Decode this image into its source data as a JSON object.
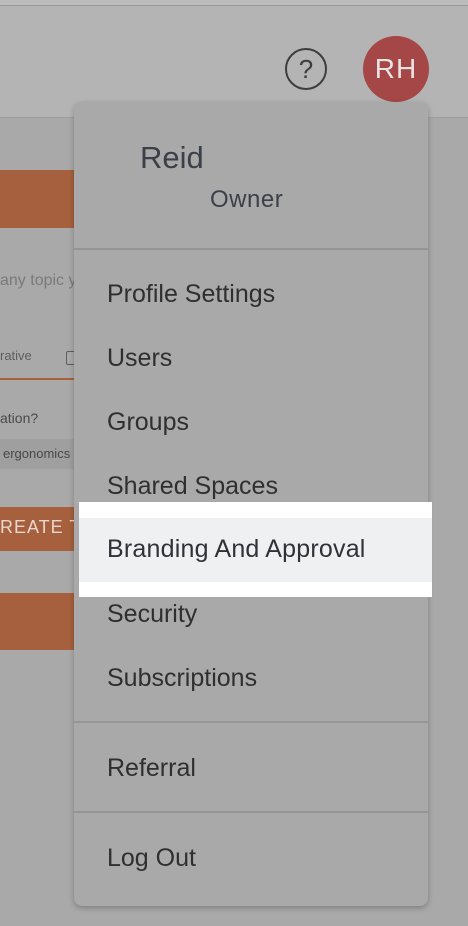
{
  "header": {
    "help_icon": "?",
    "avatar_initials": "RH"
  },
  "background": {
    "topic_placeholder": "any topic y",
    "field_label": "rative",
    "question": "ation?",
    "chip": "ergonomics",
    "create_button": "REATE TI"
  },
  "menu": {
    "user_name": "Reid",
    "user_role": "Owner",
    "items": [
      {
        "label": "Profile Settings"
      },
      {
        "label": "Users"
      },
      {
        "label": "Groups"
      },
      {
        "label": "Shared Spaces"
      },
      {
        "label": "Branding And Approval"
      },
      {
        "label": "Security"
      },
      {
        "label": "Subscriptions"
      }
    ],
    "referral": "Referral",
    "logout": "Log Out"
  },
  "colors": {
    "accent": "#a6603e",
    "avatar": "#a54747",
    "highlight": "#eff0f2"
  }
}
